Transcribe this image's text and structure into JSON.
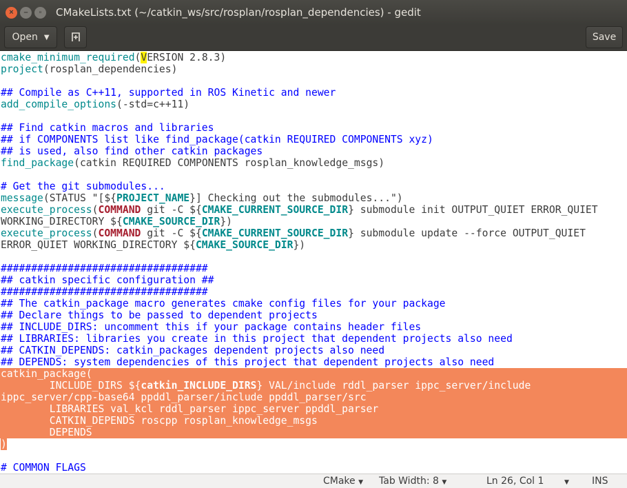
{
  "window": {
    "title": "CMakeLists.txt (~/catkin_ws/src/rosplan/rosplan_dependencies) - gedit"
  },
  "toolbar": {
    "open_label": "Open",
    "save_label": "Save"
  },
  "editor": {
    "colors": {
      "function": "#00898b",
      "comment": "#0000ff",
      "keyword": "#a51d2d",
      "selection": "#f3875a",
      "cursor_match": "#fff200"
    },
    "lines": [
      [
        [
          "f",
          "cmake_minimum_required"
        ],
        [
          "n",
          "("
        ],
        [
          "hl",
          "V"
        ],
        [
          "n",
          "ERSION 2.8.3)"
        ]
      ],
      [
        [
          "f",
          "project"
        ],
        [
          "n",
          "(rosplan_dependencies)"
        ]
      ],
      [],
      [
        [
          "c",
          "## Compile as C++11, supported in ROS Kinetic and newer"
        ]
      ],
      [
        [
          "f",
          "add_compile_options"
        ],
        [
          "n",
          "(-std=c++11)"
        ]
      ],
      [],
      [
        [
          "c",
          "## Find catkin macros and libraries"
        ]
      ],
      [
        [
          "c",
          "## if COMPONENTS list like find_package(catkin REQUIRED COMPONENTS xyz)"
        ]
      ],
      [
        [
          "c",
          "## is used, also find other catkin packages"
        ]
      ],
      [
        [
          "f",
          "find_package"
        ],
        [
          "n",
          "(catkin REQUIRED COMPONENTS rosplan_knowledge_msgs)"
        ]
      ],
      [],
      [
        [
          "c",
          "# Get the git submodules..."
        ]
      ],
      [
        [
          "f",
          "message"
        ],
        [
          "n",
          "(STATUS \"[${"
        ],
        [
          "v",
          "PROJECT_NAME"
        ],
        [
          "n",
          "}] Checking out the submodules...\")"
        ]
      ],
      [
        [
          "f",
          "execute_process"
        ],
        [
          "n",
          "("
        ],
        [
          "k",
          "COMMAND"
        ],
        [
          "n",
          " git -C ${"
        ],
        [
          "v",
          "CMAKE_CURRENT_SOURCE_DIR"
        ],
        [
          "n",
          "} submodule init OUTPUT_QUIET ERROR_QUIET"
        ]
      ],
      [
        [
          "n",
          "WORKING_DIRECTORY ${"
        ],
        [
          "v",
          "CMAKE_SOURCE_DIR"
        ],
        [
          "n",
          "})"
        ]
      ],
      [
        [
          "f",
          "execute_process"
        ],
        [
          "n",
          "("
        ],
        [
          "k",
          "COMMAND"
        ],
        [
          "n",
          " git -C ${"
        ],
        [
          "v",
          "CMAKE_CURRENT_SOURCE_DIR"
        ],
        [
          "n",
          "} submodule update --force OUTPUT_QUIET"
        ]
      ],
      [
        [
          "n",
          "ERROR_QUIET WORKING_DIRECTORY ${"
        ],
        [
          "v",
          "CMAKE_SOURCE_DIR"
        ],
        [
          "n",
          "})"
        ]
      ],
      [],
      [
        [
          "c",
          "##################################"
        ]
      ],
      [
        [
          "c",
          "## catkin specific configuration ##"
        ]
      ],
      [
        [
          "c",
          "##################################"
        ]
      ],
      [
        [
          "c",
          "## The catkin_package macro generates cmake config files for your package"
        ]
      ],
      [
        [
          "c",
          "## Declare things to be passed to dependent projects"
        ]
      ],
      [
        [
          "c",
          "## INCLUDE_DIRS: uncomment this if your package contains header files"
        ]
      ],
      [
        [
          "c",
          "## LIBRARIES: libraries you create in this project that dependent projects also need"
        ]
      ],
      [
        [
          "c",
          "## CATKIN_DEPENDS: catkin_packages dependent projects also need"
        ]
      ],
      [
        [
          "c",
          "## DEPENDS: system dependencies of this project that dependent projects also need"
        ]
      ],
      [
        [
          "n",
          "catkin_package("
        ]
      ],
      [
        [
          "n",
          "        INCLUDE_DIRS ${"
        ],
        [
          "v",
          "catkin_INCLUDE_DIRS"
        ],
        [
          "n",
          "} VAL/include rddl_parser ippc_server/include"
        ]
      ],
      [
        [
          "n",
          "ippc_server/cpp-base64 ppddl_parser/include ppddl_parser/src"
        ]
      ],
      [
        [
          "n",
          "        LIBRARIES val_kcl rddl_parser ippc_server ppddl_parser"
        ]
      ],
      [
        [
          "n",
          "        CATKIN_DEPENDS roscpp rosplan_knowledge_msgs"
        ]
      ],
      [
        [
          "n",
          "        DEPENDS"
        ]
      ],
      [
        [
          "selc",
          ")"
        ]
      ],
      [],
      [
        [
          "c",
          "# COMMON FLAGS"
        ]
      ]
    ],
    "selected_rows": [
      27,
      28,
      29,
      30,
      31,
      32
    ]
  },
  "statusbar": {
    "language": "CMake",
    "tab_width": "Tab Width: 8",
    "position": "Ln 26, Col 1",
    "mode": "INS"
  }
}
